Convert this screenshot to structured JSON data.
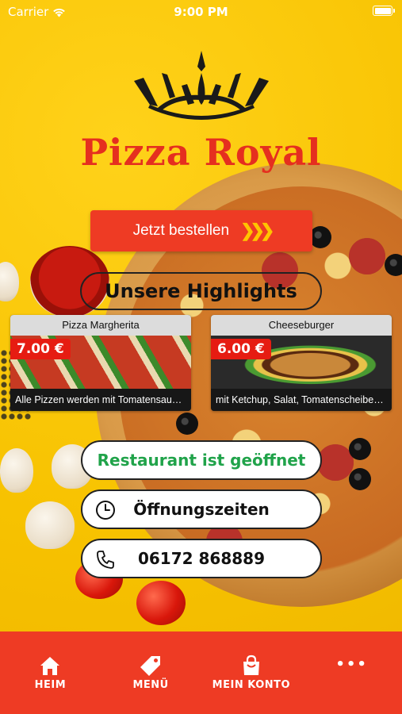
{
  "status_bar": {
    "carrier": "Carrier",
    "time": "9:00 PM"
  },
  "brand": {
    "name": "Pizza Royal"
  },
  "order_button": {
    "label": "Jetzt bestellen"
  },
  "highlights": {
    "title": "Unsere Highlights",
    "items": [
      {
        "name": "Pizza Margherita",
        "price": "7.00 €",
        "description": "Alle Pizzen werden mit Tomatensauce u..."
      },
      {
        "name": "Cheeseburger",
        "price": "6.00 €",
        "description": "mit Ketchup, Salat, Tomatenscheiben, s..."
      }
    ]
  },
  "info": {
    "status": "Restaurant ist geöffnet",
    "hours_label": "Öffnungszeiten",
    "phone": "06172 868889"
  },
  "tab_bar": {
    "items": [
      {
        "label": "HEIM",
        "icon": "home-icon"
      },
      {
        "label": "MENÜ",
        "icon": "tag-icon"
      },
      {
        "label": "MEIN KONTO",
        "icon": "shopping-bag-icon"
      },
      {
        "label": "•••",
        "icon": "more-icon"
      }
    ]
  },
  "colors": {
    "accent_red": "#ee3b24",
    "brand_red": "#e52f1f",
    "open_green": "#20a34a",
    "background_yellow": "#f5c400"
  }
}
